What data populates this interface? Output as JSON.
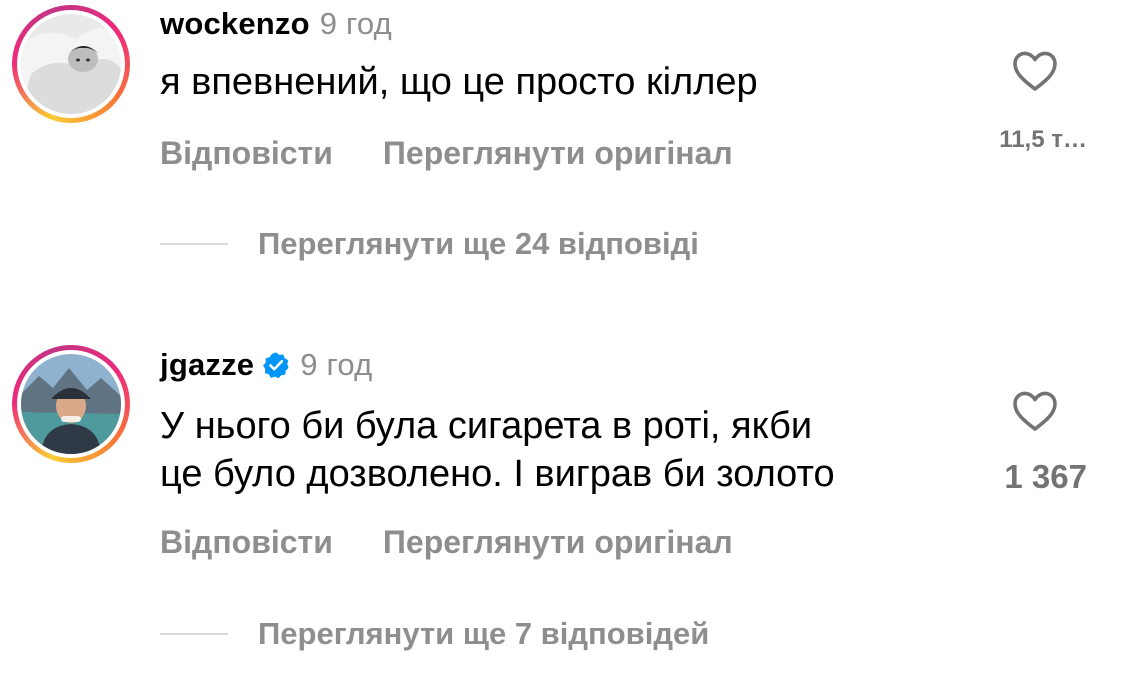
{
  "comments": [
    {
      "username": "wockenzo",
      "time": "9 год",
      "verified": false,
      "text": "я впевнений, що це просто кіллер",
      "reply_label": "Відповісти",
      "translate_label": "Переглянути оригінал",
      "likes": "11,5 т…",
      "more_replies": "Переглянути ще 24 відповіді"
    },
    {
      "username": "jgazze",
      "time": "9 год",
      "verified": true,
      "text_line1": "У нього би була сигарета в роті, якби",
      "text_line2": "це було дозволено. І виграв би золото",
      "reply_label": "Відповісти",
      "translate_label": "Переглянути оригінал",
      "likes": "1 367",
      "more_replies": "Переглянути ще 7 відповідей"
    }
  ],
  "colors": {
    "secondary_text": "#8e8e8e",
    "verified_blue": "#0095f6",
    "divider": "#dbdbdb"
  },
  "icons": {
    "like": "heart-outline-icon",
    "verified": "verified-badge-icon"
  }
}
